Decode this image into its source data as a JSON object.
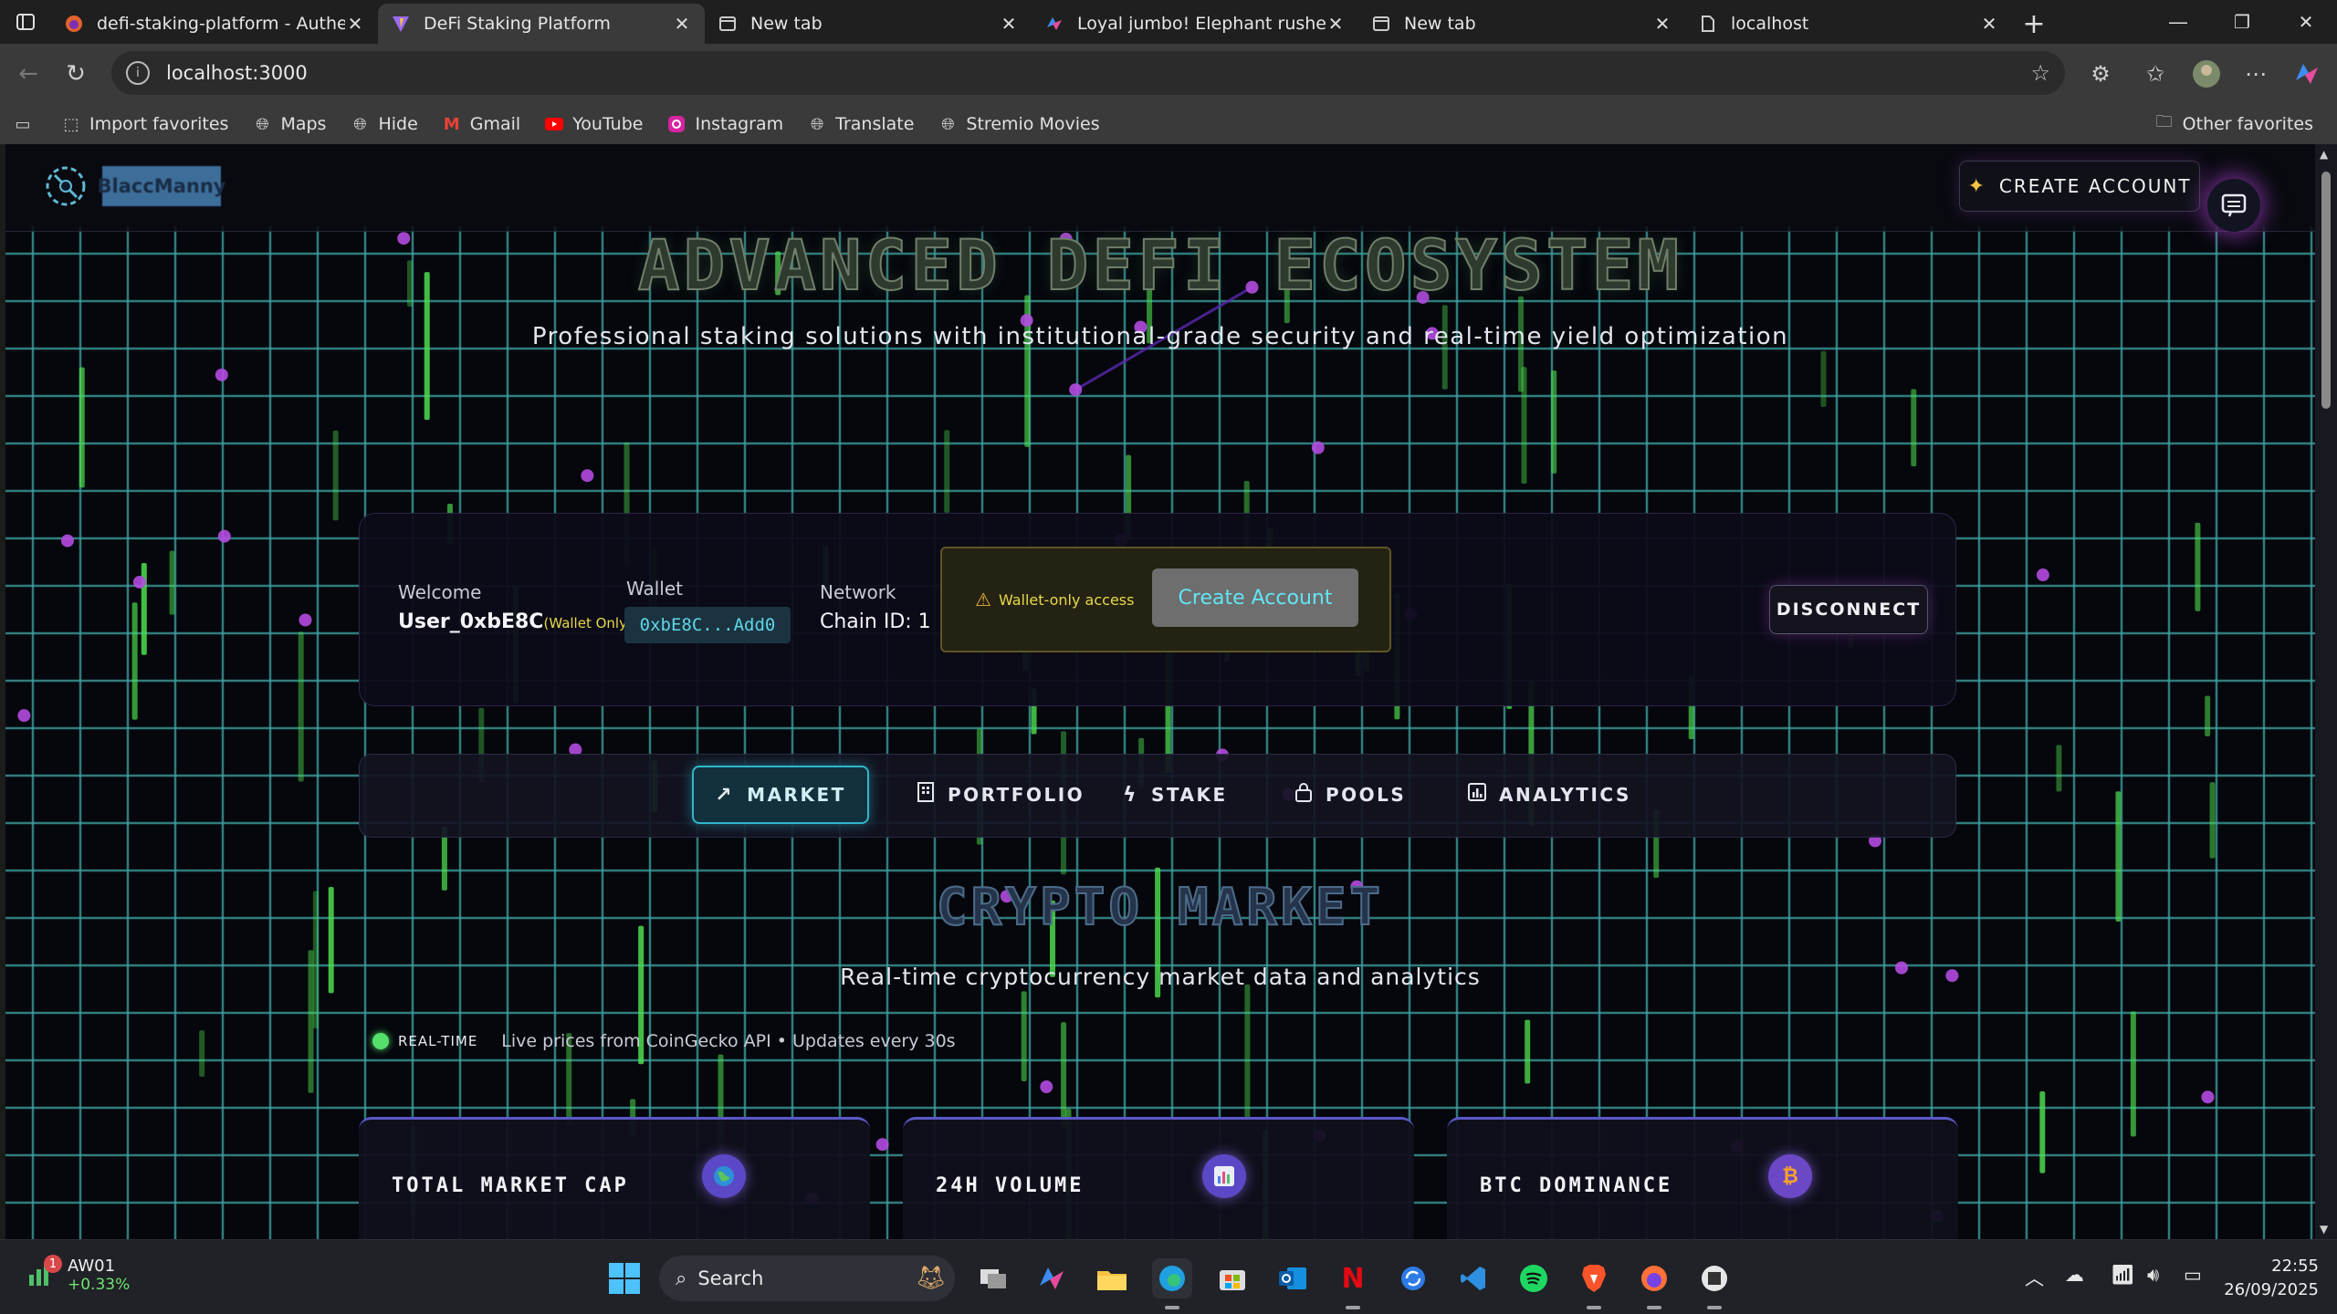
{
  "browser": {
    "tabs": [
      {
        "title": "defi-staking-platform - Authentic",
        "icon": "firefox-icon",
        "active": false
      },
      {
        "title": "DeFi Staking Platform",
        "icon": "vite-icon",
        "active": true
      },
      {
        "title": "New tab",
        "icon": "newtab-icon",
        "active": false
      },
      {
        "title": "Loyal jumbo! Elephant rushes to s",
        "icon": "copilot-icon",
        "active": false
      },
      {
        "title": "New tab",
        "icon": "newtab-icon",
        "active": false
      },
      {
        "title": "localhost",
        "icon": "page-icon",
        "active": false
      }
    ],
    "url": "localhost:3000",
    "bookmarks": [
      {
        "label": "Import favorites",
        "icon": "import-icon"
      },
      {
        "label": "Maps",
        "icon": "globe-icon"
      },
      {
        "label": "Hide",
        "icon": "globe-icon"
      },
      {
        "label": "Gmail",
        "icon": "gmail-icon"
      },
      {
        "label": "YouTube",
        "icon": "youtube-icon"
      },
      {
        "label": "Instagram",
        "icon": "instagram-icon"
      },
      {
        "label": "Translate",
        "icon": "globe-icon"
      },
      {
        "label": "Stremio Movies",
        "icon": "globe-icon"
      }
    ],
    "other_favorites": "Other favorites"
  },
  "site": {
    "brand": "BlaccManny",
    "create_account_top": "CREATE ACCOUNT",
    "hero_title": "ADVANCED DEFI ECOSYSTEM",
    "hero_subtitle": "Professional staking solutions with institutional-grade security and real-time yield optimization"
  },
  "wallet": {
    "welcome_label": "Welcome",
    "user": "User_0xbE8C",
    "wallet_only_tag": "(Wallet Only)",
    "wallet_label": "Wallet",
    "address": "0xbE8C...Add0",
    "network_label": "Network",
    "network": "Chain ID: 1",
    "access_warning": "Wallet-only access",
    "create_account": "Create Account",
    "disconnect": "DISCONNECT"
  },
  "nav": [
    {
      "label": "MARKET",
      "icon": "trend-up-icon",
      "active": true
    },
    {
      "label": "PORTFOLIO",
      "icon": "building-icon",
      "active": false
    },
    {
      "label": "STAKE",
      "icon": "bolt-icon",
      "active": false
    },
    {
      "label": "POOLS",
      "icon": "lock-icon",
      "active": false
    },
    {
      "label": "ANALYTICS",
      "icon": "bar-chart-icon",
      "active": false
    }
  ],
  "market": {
    "title": "CRYPTO MARKET",
    "subtitle": "Real-time cryptocurrency market data and analytics",
    "realtime_label": "REAL-TIME",
    "realtime_text": "Live prices from CoinGecko API • Updates every 30s",
    "cards": [
      {
        "title": "TOTAL MARKET CAP",
        "icon": "globe-icon"
      },
      {
        "title": "24H VOLUME",
        "icon": "bar-chart-icon"
      },
      {
        "title": "BTC DOMINANCE",
        "icon": "bitcoin-icon"
      }
    ]
  },
  "taskbar": {
    "stock_name": "AW01",
    "stock_change": "+0.33%",
    "notification_count": "1",
    "search_placeholder": "Search",
    "time": "22:55",
    "date": "26/09/2025"
  },
  "colors": {
    "accent_cyan": "#2fb7c9",
    "grid_line": "#3fa3a3",
    "purple_glow": "#b44be0",
    "matrix_green": "#4fe04f"
  }
}
